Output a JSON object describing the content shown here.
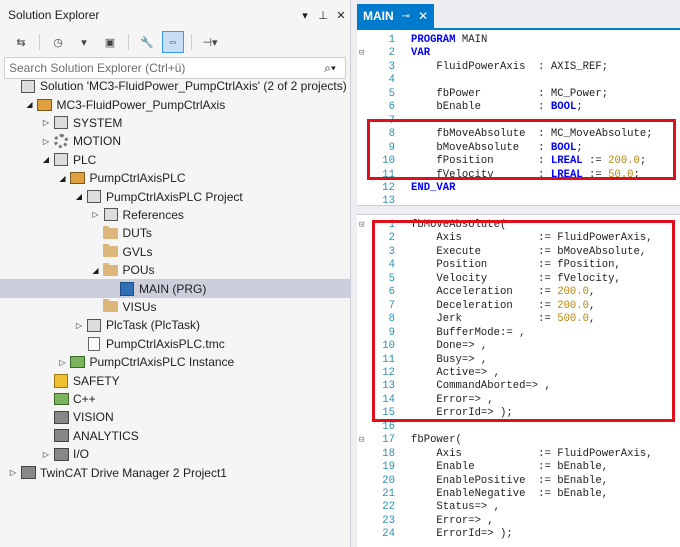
{
  "solution_explorer": {
    "title": "Solution Explorer",
    "search_placeholder": "Search Solution Explorer (Ctrl+ü)",
    "tree": [
      {
        "label": "Solution 'MC3-FluidPower_PumpCtrlAxis' (2 of 2 projects)",
        "icon": "solution-icon",
        "arrow": ""
      },
      {
        "label": "MC3-FluidPower_PumpCtrlAxis",
        "icon": "twincat-project-icon",
        "arrow": "expanded"
      },
      {
        "label": "SYSTEM",
        "icon": "system-icon",
        "arrow": "collapsed"
      },
      {
        "label": "MOTION",
        "icon": "motion-icon",
        "arrow": "collapsed"
      },
      {
        "label": "PLC",
        "icon": "plc-icon",
        "arrow": "expanded"
      },
      {
        "label": "PumpCtrlAxisPLC",
        "icon": "plc-project-icon",
        "arrow": "expanded"
      },
      {
        "label": "PumpCtrlAxisPLC Project",
        "icon": "plc-subproject-icon",
        "arrow": "expanded"
      },
      {
        "label": "References",
        "icon": "references-icon",
        "arrow": "collapsed"
      },
      {
        "label": "DUTs",
        "icon": "folder-icon",
        "arrow": ""
      },
      {
        "label": "GVLs",
        "icon": "folder-icon",
        "arrow": ""
      },
      {
        "label": "POUs",
        "icon": "folder-icon",
        "arrow": "expanded"
      },
      {
        "label": "MAIN (PRG)",
        "icon": "program-icon",
        "arrow": ""
      },
      {
        "label": "VISUs",
        "icon": "folder-icon",
        "arrow": ""
      },
      {
        "label": "PlcTask (PlcTask)",
        "icon": "task-icon",
        "arrow": "collapsed"
      },
      {
        "label": "PumpCtrlAxisPLC.tmc",
        "icon": "tmc-file-icon",
        "arrow": ""
      },
      {
        "label": "PumpCtrlAxisPLC Instance",
        "icon": "instance-icon",
        "arrow": "collapsed"
      },
      {
        "label": "SAFETY",
        "icon": "safety-icon",
        "arrow": ""
      },
      {
        "label": "C++",
        "icon": "cpp-icon",
        "arrow": ""
      },
      {
        "label": "VISION",
        "icon": "vision-icon",
        "arrow": ""
      },
      {
        "label": "ANALYTICS",
        "icon": "analytics-icon",
        "arrow": ""
      },
      {
        "label": "I/O",
        "icon": "io-icon",
        "arrow": "collapsed"
      },
      {
        "label": "TwinCAT Drive Manager 2 Project1",
        "icon": "drive-manager-icon",
        "arrow": "collapsed"
      }
    ]
  },
  "editor": {
    "tab_label": "MAIN",
    "decl": [
      {
        "n": "1",
        "t": [
          [
            "kw",
            "PROGRAM"
          ],
          [
            "p",
            " MAIN"
          ]
        ]
      },
      {
        "n": "2",
        "t": [
          [
            "kw",
            "VAR"
          ]
        ]
      },
      {
        "n": "3",
        "t": [
          [
            "p",
            "    FluidPowerAxis  : AXIS_REF;"
          ]
        ]
      },
      {
        "n": "4",
        "t": []
      },
      {
        "n": "5",
        "t": [
          [
            "p",
            "    fbPower         : MC_Power;"
          ]
        ]
      },
      {
        "n": "6",
        "t": [
          [
            "p",
            "    bEnable         : "
          ],
          [
            "kw",
            "BOOL"
          ],
          [
            "p",
            ";"
          ]
        ]
      },
      {
        "n": "7",
        "t": []
      },
      {
        "n": "8",
        "t": [
          [
            "p",
            "    fbMoveAbsolute  : MC_MoveAbsolute;"
          ]
        ]
      },
      {
        "n": "9",
        "t": [
          [
            "p",
            "    bMoveAbsolute   : "
          ],
          [
            "kw",
            "BOOL"
          ],
          [
            "p",
            ";"
          ]
        ]
      },
      {
        "n": "10",
        "t": [
          [
            "p",
            "    fPosition       : "
          ],
          [
            "kw",
            "LREAL"
          ],
          [
            "p",
            " := "
          ],
          [
            "num",
            "200.0"
          ],
          [
            "p",
            ";"
          ]
        ]
      },
      {
        "n": "11",
        "t": [
          [
            "p",
            "    fVelocity       : "
          ],
          [
            "kw",
            "LREAL"
          ],
          [
            "p",
            " := "
          ],
          [
            "num",
            "50.0"
          ],
          [
            "p",
            ";"
          ]
        ]
      },
      {
        "n": "12",
        "t": [
          [
            "kw",
            "END_VAR"
          ]
        ]
      },
      {
        "n": "13",
        "t": []
      }
    ],
    "impl": [
      {
        "n": "1",
        "t": [
          [
            "p",
            "fbMoveAbsolute("
          ]
        ]
      },
      {
        "n": "2",
        "t": [
          [
            "p",
            "    Axis            := FluidPowerAxis,"
          ]
        ]
      },
      {
        "n": "3",
        "t": [
          [
            "p",
            "    Execute         := bMoveAbsolute,"
          ]
        ]
      },
      {
        "n": "4",
        "t": [
          [
            "p",
            "    Position        := fPosition,"
          ]
        ]
      },
      {
        "n": "5",
        "t": [
          [
            "p",
            "    Velocity        := fVelocity,"
          ]
        ]
      },
      {
        "n": "6",
        "t": [
          [
            "p",
            "    Acceleration    := "
          ],
          [
            "num",
            "200.0"
          ],
          [
            "p",
            ","
          ]
        ]
      },
      {
        "n": "7",
        "t": [
          [
            "p",
            "    Deceleration    := "
          ],
          [
            "num",
            "200.0"
          ],
          [
            "p",
            ","
          ]
        ]
      },
      {
        "n": "8",
        "t": [
          [
            "p",
            "    Jerk            := "
          ],
          [
            "num",
            "500.0"
          ],
          [
            "p",
            ","
          ]
        ]
      },
      {
        "n": "9",
        "t": [
          [
            "p",
            "    BufferMode:= ,"
          ]
        ]
      },
      {
        "n": "10",
        "t": [
          [
            "p",
            "    Done=> ,"
          ]
        ]
      },
      {
        "n": "11",
        "t": [
          [
            "p",
            "    Busy=> ,"
          ]
        ]
      },
      {
        "n": "12",
        "t": [
          [
            "p",
            "    Active=> ,"
          ]
        ]
      },
      {
        "n": "13",
        "t": [
          [
            "p",
            "    CommandAborted=> ,"
          ]
        ]
      },
      {
        "n": "14",
        "t": [
          [
            "p",
            "    Error=> ,"
          ]
        ]
      },
      {
        "n": "15",
        "t": [
          [
            "p",
            "    ErrorId=> );"
          ]
        ]
      },
      {
        "n": "16",
        "t": []
      },
      {
        "n": "17",
        "t": [
          [
            "p",
            "fbPower("
          ]
        ]
      },
      {
        "n": "18",
        "t": [
          [
            "p",
            "    Axis            := FluidPowerAxis,"
          ]
        ]
      },
      {
        "n": "19",
        "t": [
          [
            "p",
            "    Enable          := bEnable,"
          ]
        ]
      },
      {
        "n": "20",
        "t": [
          [
            "p",
            "    EnablePositive  := bEnable,"
          ]
        ]
      },
      {
        "n": "21",
        "t": [
          [
            "p",
            "    EnableNegative  := bEnable,"
          ]
        ]
      },
      {
        "n": "22",
        "t": [
          [
            "p",
            "    Status=> ,"
          ]
        ]
      },
      {
        "n": "23",
        "t": [
          [
            "p",
            "    Error=> ,"
          ]
        ]
      },
      {
        "n": "24",
        "t": [
          [
            "p",
            "    ErrorId=> );"
          ]
        ]
      }
    ]
  },
  "colors": {
    "keyword": "#0000ff",
    "number": "#b8860b",
    "plain": "#1e1e1e",
    "highlight_box": "#e0101a",
    "tab_active": "#007acc"
  }
}
